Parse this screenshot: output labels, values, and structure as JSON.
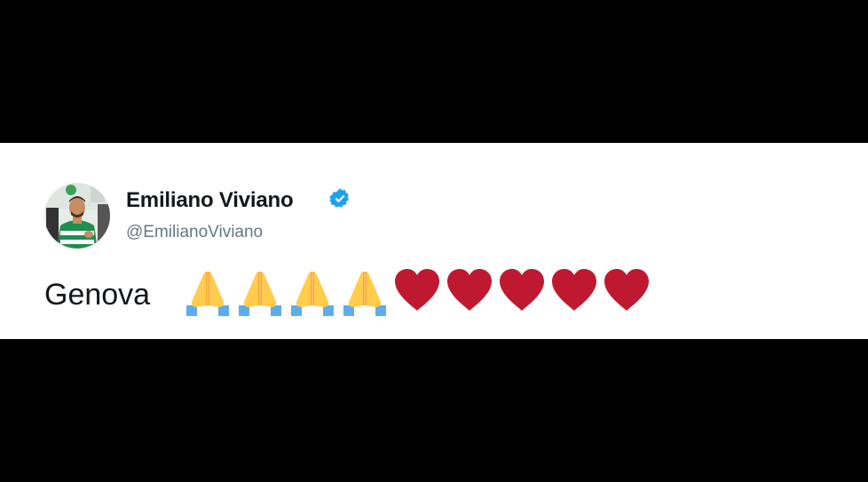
{
  "tweet": {
    "display_name": "Emiliano Viviano",
    "handle": "@EmilianoViviano",
    "verified": true,
    "text": "Genova",
    "emojis": [
      {
        "icon": "folded-hands-emoji",
        "char": "🙏"
      },
      {
        "icon": "folded-hands-emoji",
        "char": "🙏"
      },
      {
        "icon": "folded-hands-emoji",
        "char": "🙏"
      },
      {
        "icon": "folded-hands-emoji",
        "char": "🙏"
      },
      {
        "icon": "red-heart-emoji",
        "char": "❤"
      },
      {
        "icon": "red-heart-emoji",
        "char": "❤"
      },
      {
        "icon": "red-heart-emoji",
        "char": "❤"
      },
      {
        "icon": "red-heart-emoji",
        "char": "❤"
      },
      {
        "icon": "red-heart-emoji",
        "char": "❤"
      }
    ]
  },
  "colors": {
    "background": "#000000",
    "card": "#ffffff",
    "name": "#14171a",
    "handle": "#657786",
    "verified": "#1da1f2",
    "heart": "#be1931",
    "pray_hands": "#ffcc4d",
    "pray_sleeves": "#5dadec"
  }
}
